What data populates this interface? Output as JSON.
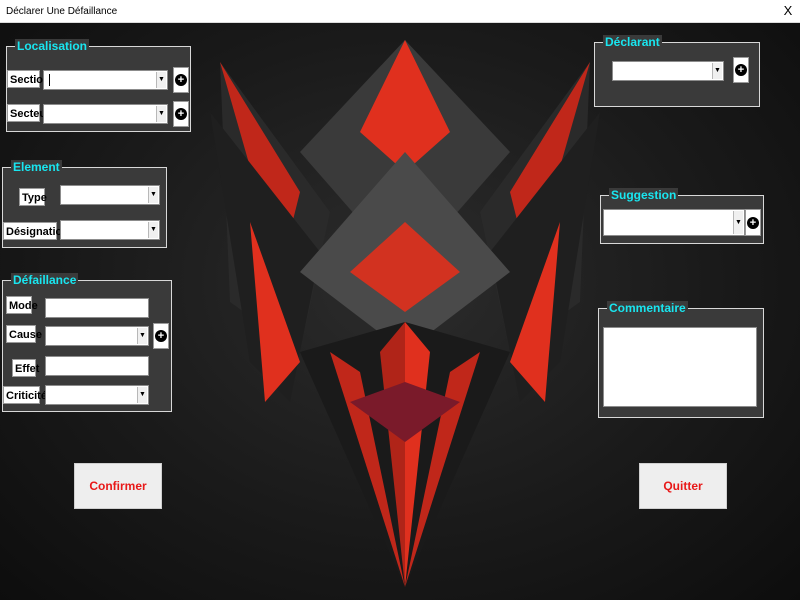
{
  "window": {
    "title": "Déclarer Une Défaillance",
    "close_glyph": "X"
  },
  "localisation": {
    "legend": "Localisation",
    "section_label": "Section",
    "section_value": "",
    "secteur_label": "Secteur",
    "secteur_value": "",
    "add_icon": "plus-circle-icon"
  },
  "element": {
    "legend": "Element",
    "type_label": "Type",
    "type_value": "",
    "designation_label": "Désignation",
    "designation_value": ""
  },
  "defaillance": {
    "legend": "Défaillance",
    "mode_label": "Mode",
    "mode_value": "",
    "cause_label": "Cause",
    "cause_value": "",
    "effet_label": "Effet",
    "effet_value": "",
    "criticite_label": "Criticité",
    "criticite_value": ""
  },
  "declarant": {
    "legend": "Déclarant",
    "value": ""
  },
  "suggestion": {
    "legend": "Suggestion",
    "value": ""
  },
  "commentaire": {
    "legend": "Commentaire",
    "value": ""
  },
  "buttons": {
    "confirm_label": "Confirmer",
    "quit_label": "Quitter"
  },
  "colors": {
    "legend_text": "#19e6f0",
    "button_text": "#e81818",
    "frame_bg": "#3a3a3a"
  }
}
